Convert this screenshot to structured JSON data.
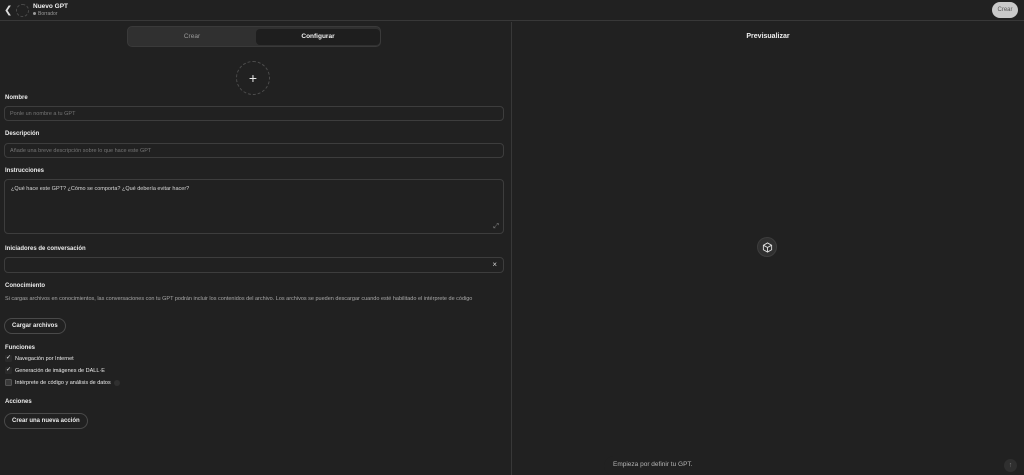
{
  "header": {
    "title": "Nuevo GPT",
    "status": "Borrador",
    "create_label": "Crear"
  },
  "tabs": [
    {
      "label": "Crear",
      "active": false
    },
    {
      "label": "Configurar",
      "active": true
    }
  ],
  "form": {
    "name": {
      "label": "Nombre",
      "placeholder": "Ponle un nombre a tu GPT"
    },
    "description": {
      "label": "Descripción",
      "placeholder": "Añade una breve descripción sobre lo que hace este GPT"
    },
    "instructions": {
      "label": "Instrucciones",
      "placeholder": "¿Qué hace este GPT? ¿Cómo se comporta? ¿Qué debería evitar hacer?"
    },
    "starters": {
      "label": "Iniciadores de conversación"
    },
    "knowledge": {
      "label": "Conocimiento",
      "help": "Si cargas archivos en conocimientos, las conversaciones con tu GPT podrán incluir los contenidos del archivo. Los archivos se pueden descargar cuando esté habilitado el intérprete de código",
      "upload_label": "Cargar archivos"
    },
    "capabilities": {
      "label": "Funciones",
      "items": [
        {
          "label": "Navegación por Internet",
          "checked": true
        },
        {
          "label": "Generación de imágenes de DALL·E",
          "checked": true
        },
        {
          "label": "Intérprete de código y análisis de datos",
          "checked": false
        }
      ]
    },
    "actions": {
      "label": "Acciones",
      "create_label": "Crear una nueva acción"
    }
  },
  "preview": {
    "title": "Previsualizar",
    "placeholder": "Empieza por definir tu GPT."
  }
}
